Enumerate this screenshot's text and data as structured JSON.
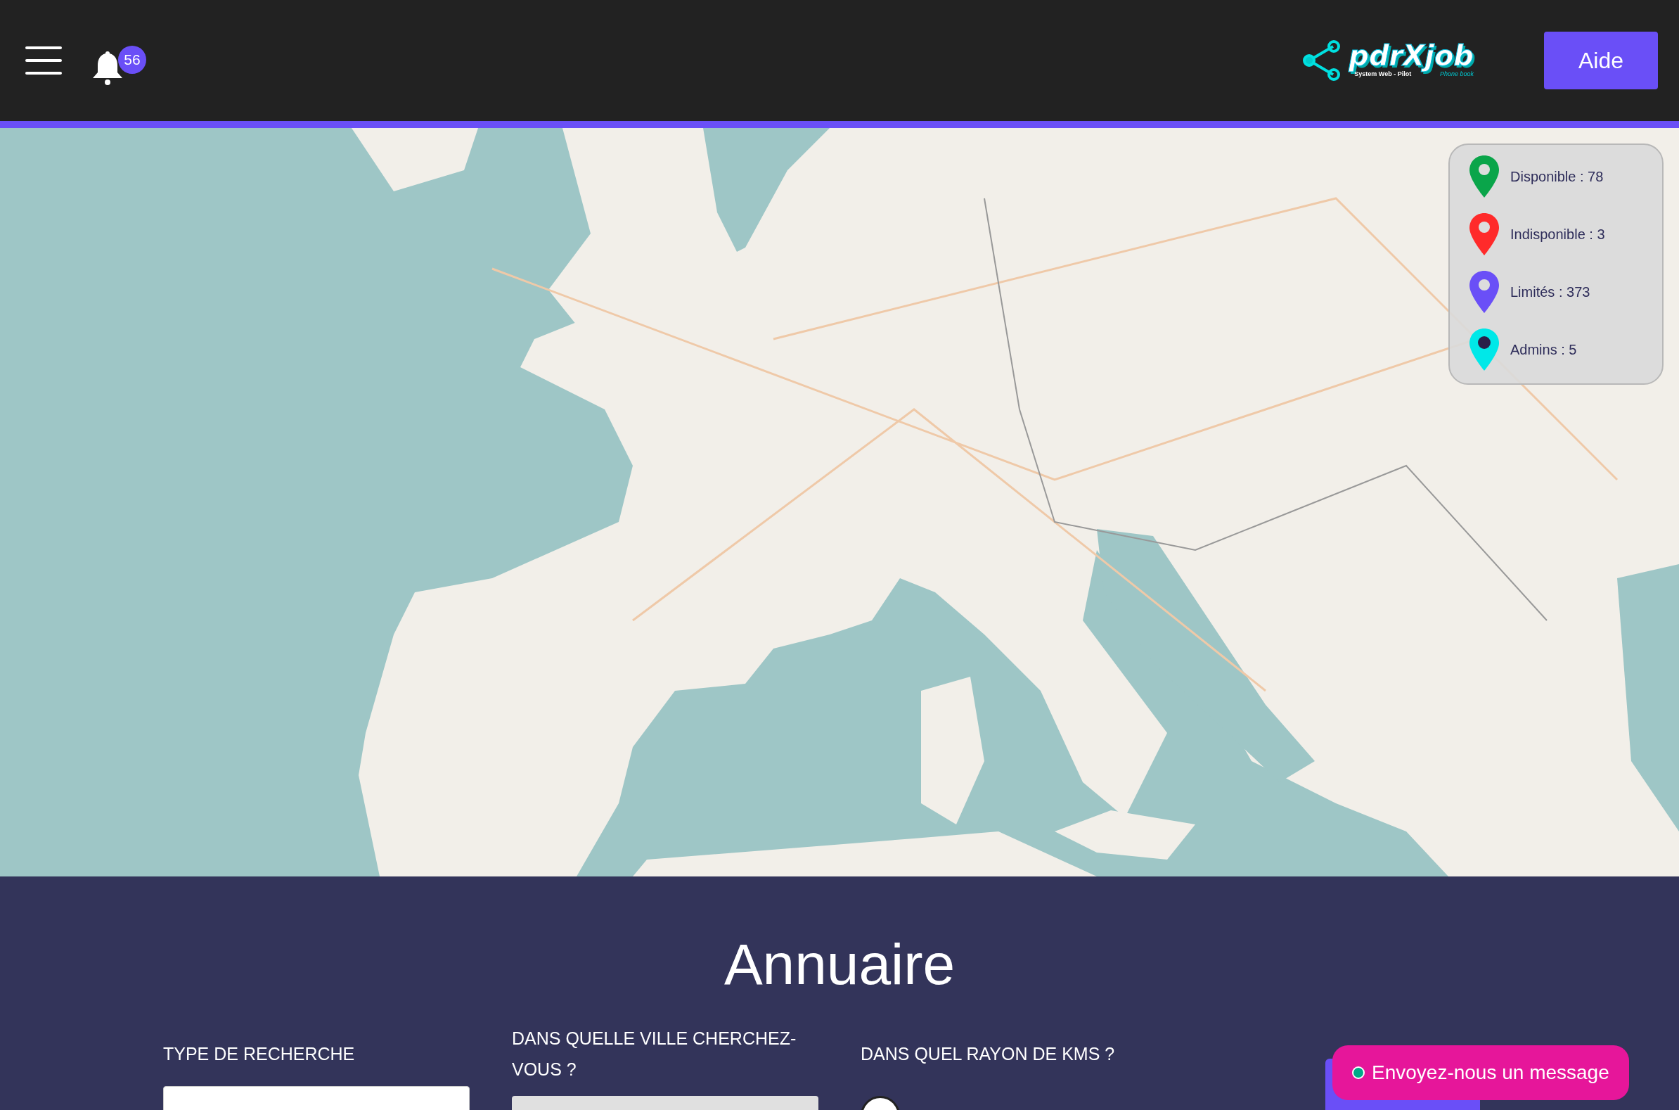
{
  "header": {
    "notifications": "56",
    "logo": {
      "name": "pdrXjob",
      "tagline": "System Web - Pilot",
      "subtitle": "Phone book"
    },
    "help_button": "Aide"
  },
  "map": {
    "kind": "picture",
    "legend": [
      {
        "label": "Disponible : 78",
        "color": "#0aa54a"
      },
      {
        "label": "Indisponible : 3",
        "color": "#ff2a2a"
      },
      {
        "label": "Limités : 373",
        "color": "#6a4ff7"
      },
      {
        "label": "Admins : 5",
        "color": "#00e8e8"
      }
    ]
  },
  "directory": {
    "title": "Annuaire",
    "fields": [
      {
        "label": "TYPE DE RECHERCHE",
        "kind": "input"
      },
      {
        "label": "DANS QUELLE VILLE CHERCHEZ-VOUS ?",
        "kind": "select"
      },
      {
        "label": "DANS QUEL RAYON DE KMS ?",
        "kind": "slider"
      }
    ]
  },
  "chat_button": "Envoyez-nous un message"
}
